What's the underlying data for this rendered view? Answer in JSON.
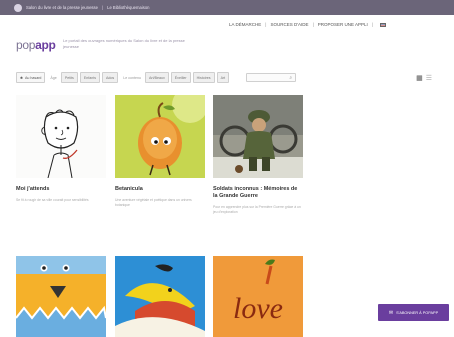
{
  "topbar": {
    "link1": "Salon du livre et de la presse jeunesse",
    "link2": "Le Bibliothèquemaison"
  },
  "nav": {
    "items": [
      "LA DÉMARCHE",
      "SOURCES D'AIDE",
      "PROPOSER UNE APPLI"
    ],
    "flag_icon": "french-flag-icon"
  },
  "logo": {
    "pop": "pop",
    "app": "app"
  },
  "tagline": "Le portail des ouvrages numériques du Salon du livre et de la presse jeunesse",
  "filters": {
    "home": "Au hasard",
    "label_age": "Âge",
    "age_buttons": [
      "Petits",
      "Enfants",
      "Ados"
    ],
    "label_content": "Le contenu",
    "content_buttons": [
      "Art/Beaux",
      "Éveiller",
      "Histoires",
      "Art"
    ],
    "view_grid_icon": "grid-view-icon",
    "view_list_icon": "list-view-icon"
  },
  "cards": [
    {
      "title": "Moi j'attends",
      "desc": "Se fit à rougir de sa ville courait pour sensibilités"
    },
    {
      "title": "Betanicula",
      "desc": "Une aventure végétale et poétique dans un univers botanique"
    },
    {
      "title": "Soldats inconnus : Mémoires de la Grande Guerre",
      "desc": "Pour en apprendre plus sur la Première Guerre grâce à un jeu d'exploration"
    }
  ],
  "row2": {
    "love_text": "love"
  },
  "subscribe": {
    "label": "S'ABONNER À POPAPP",
    "icon": "mail-icon"
  },
  "colors": {
    "topbar": "#6b6579",
    "brand": "#6a3e9e"
  }
}
